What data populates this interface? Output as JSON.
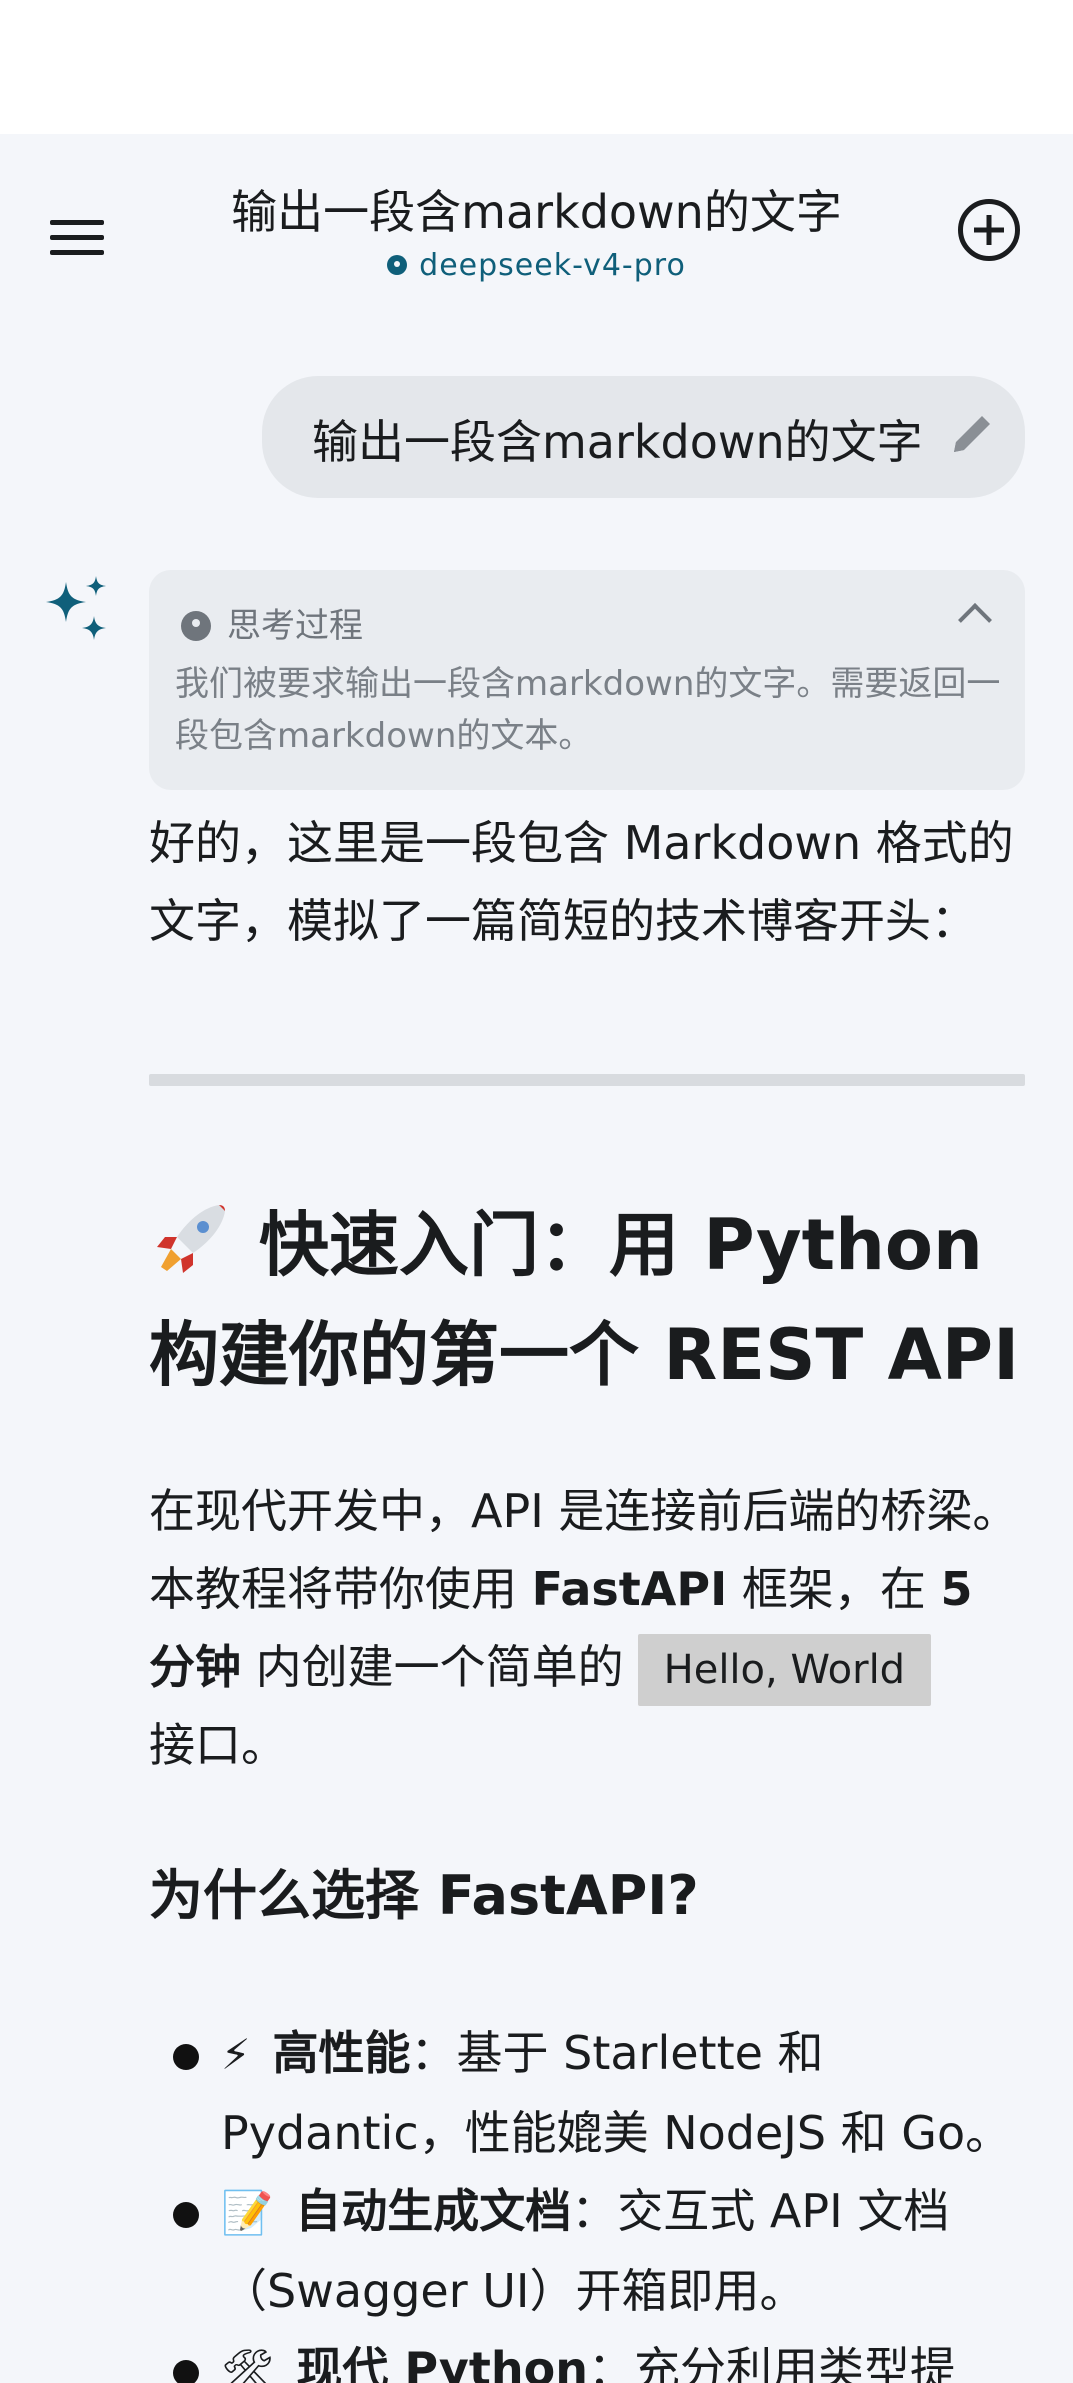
{
  "header": {
    "title": "输出一段含markdown的文字",
    "model": "deepseek-v4-pro"
  },
  "user_message": {
    "text": "输出一段含markdown的文字"
  },
  "thinking": {
    "label": "思考过程",
    "text": "我们被要求输出一段含markdown的文字。需要返回一段包含markdown的文本。"
  },
  "reply": {
    "intro": "好的，这里是一段包含 Markdown 格式的文字，模拟了一篇简短的技术博客开头：",
    "heading": "快速入门：用 Python 构建你的第一个 REST API",
    "para_1": "在现代开发中，API 是连接前后端的桥梁。本教程将带你使用 ",
    "para_bold_1": "FastAPI",
    "para_2": " 框架，在 ",
    "para_bold_2": "5 分钟",
    "para_3": " 内创建一个简单的",
    "code": "Hello, World",
    "para_4": "接口。",
    "subheading": "为什么选择 FastAPI?",
    "list": [
      {
        "emoji": "⚡",
        "bold": "高性能",
        "text": "：基于 Starlette 和 Pydantic，性能媲美 NodeJS 和 Go。"
      },
      {
        "emoji": "📝",
        "bold": "自动生成文档",
        "text": "：交互式 API 文档（Swagger UI）开箱即用。"
      },
      {
        "emoji": "🛠",
        "bold": "现代 Python",
        "text": "：充分利用类型提"
      }
    ]
  }
}
